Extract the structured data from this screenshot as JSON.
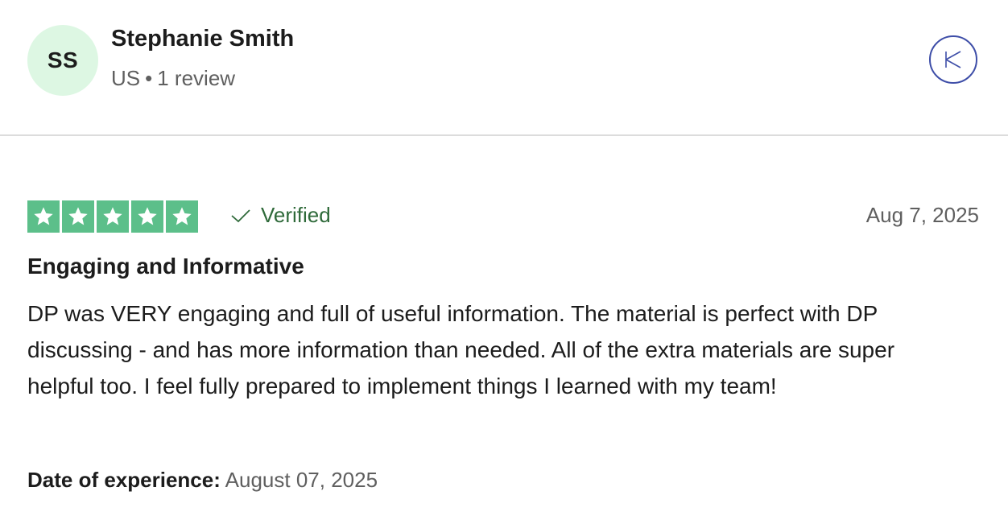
{
  "reviewer": {
    "initials": "SS",
    "name": "Stephanie Smith",
    "country": "US",
    "separator": "•",
    "review_count": "1 review"
  },
  "close": {
    "icon": "close-icon"
  },
  "review": {
    "rating": 5,
    "max_rating": 5,
    "verified_label": "Verified",
    "date": "Aug 7, 2025",
    "title": "Engaging and Informative",
    "body": "DP was VERY engaging and full of useful information. The material is perfect with DP discussing - and has more information than needed. All of the extra materials are super helpful too. I feel fully prepared to implement things I learned with my team!",
    "experience_label": "Date of experience:",
    "experience_date": "August 07, 2025"
  },
  "colors": {
    "star_fill": "#5cbf8a",
    "avatar_bg": "#ddf7e3",
    "verified_text": "#2f6a3a",
    "close_border": "#3e4ea8"
  }
}
